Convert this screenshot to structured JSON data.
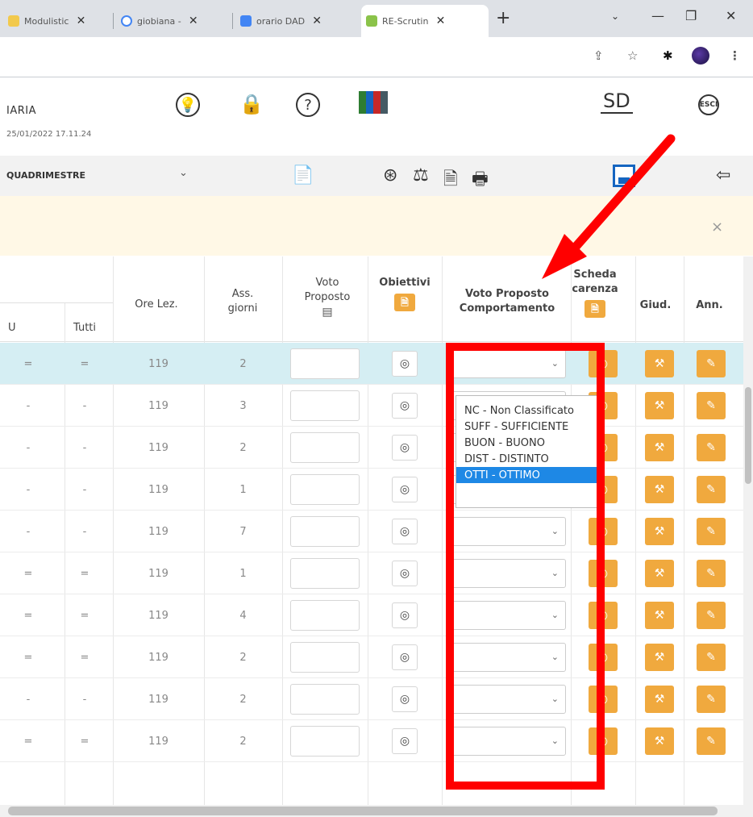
{
  "browser": {
    "tabs": [
      {
        "label": "Modulistic",
        "favicon_color": "#f2c94c"
      },
      {
        "label": "giobiana -",
        "favicon_color": "#4285f4"
      },
      {
        "label": "orario DAD",
        "favicon_color": "#4285f4"
      },
      {
        "label": "RE-Scrutin",
        "favicon_color": "#8bc34a"
      }
    ],
    "new_tab": "+",
    "close_glyph": "✕"
  },
  "header": {
    "user_name": "IARIA",
    "timestamp": "25/01/2022 17.11.24",
    "logo": "SD",
    "esc_label": "ESCI"
  },
  "toolbar": {
    "period": "QUADRIMESTRE"
  },
  "notice": {
    "close": "×"
  },
  "table": {
    "headers": {
      "u": "U",
      "tutti": "Tutti",
      "ore_lez": "Ore Lez.",
      "ass_giorni_1": "Ass.",
      "ass_giorni_2": "giorni",
      "voto_proposto_1": "Voto",
      "voto_proposto_2": "Proposto",
      "obiettivi": "Obiettivi",
      "comportamento_1": "Voto Proposto",
      "comportamento_2": "Comportamento",
      "scheda_1": "Scheda",
      "scheda_2": "carenza",
      "giud": "Giud.",
      "ann": "Ann."
    },
    "rows": [
      {
        "u": "=",
        "tutti": "=",
        "ore": "119",
        "ass": "2"
      },
      {
        "u": "-",
        "tutti": "-",
        "ore": "119",
        "ass": "3"
      },
      {
        "u": "-",
        "tutti": "-",
        "ore": "119",
        "ass": "2"
      },
      {
        "u": "-",
        "tutti": "-",
        "ore": "119",
        "ass": "1"
      },
      {
        "u": "-",
        "tutti": "-",
        "ore": "119",
        "ass": "7"
      },
      {
        "u": "=",
        "tutti": "=",
        "ore": "119",
        "ass": "1"
      },
      {
        "u": "=",
        "tutti": "=",
        "ore": "119",
        "ass": "4"
      },
      {
        "u": "=",
        "tutti": "=",
        "ore": "119",
        "ass": "2"
      },
      {
        "u": "-",
        "tutti": "-",
        "ore": "119",
        "ass": "2"
      },
      {
        "u": "=",
        "tutti": "=",
        "ore": "119",
        "ass": "2"
      }
    ]
  },
  "dropdown": {
    "options": [
      "NC - Non Classificato",
      "SUFF - SUFFICIENTE",
      "BUON - BUONO",
      "DIST - DISTINTO",
      "OTTI - OTTIMO"
    ],
    "selected": "OTTI - OTTIMO"
  },
  "colors": {
    "accent_orange": "#f0a93e",
    "highlight_row": "#d5eef3",
    "annotation_red": "#ff0000",
    "selected_option": "#1e88e5"
  }
}
